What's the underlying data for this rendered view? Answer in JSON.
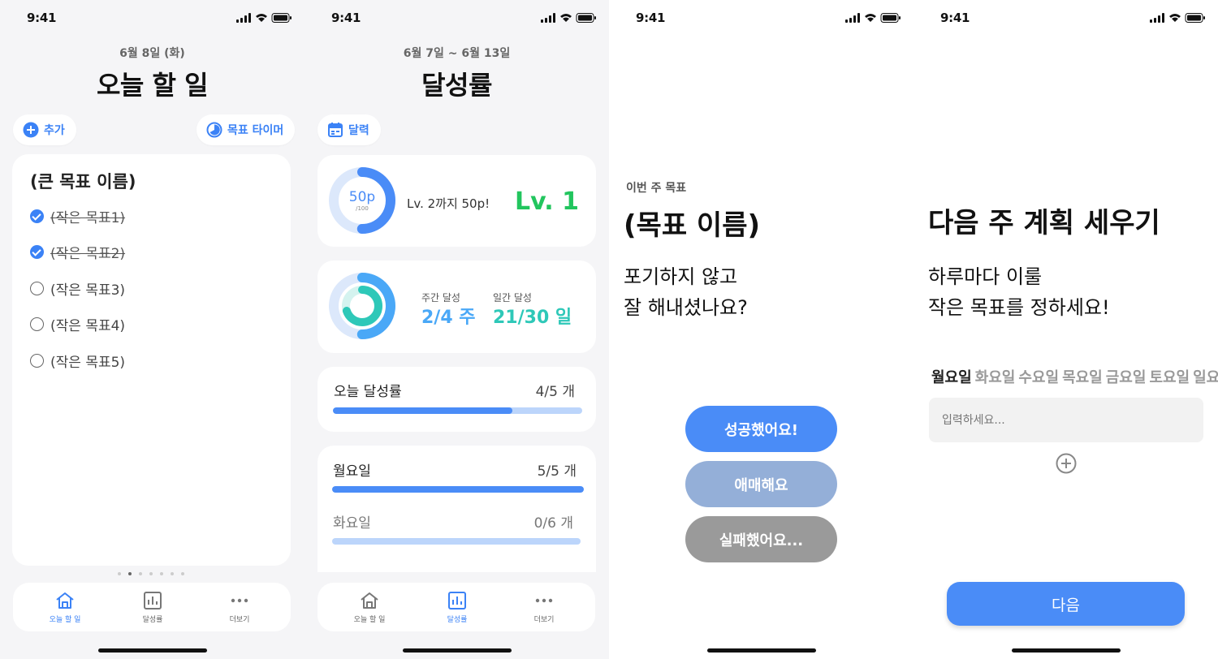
{
  "status_bar": {
    "time": "9:41"
  },
  "screen1": {
    "date": "6월 8일 (화)",
    "title": "오늘 할 일",
    "add_label": "추가",
    "timer_label": "목표 타이머",
    "goal_title": "(큰 목표 이름)",
    "tasks": [
      {
        "label": "(작은 목표1)",
        "done": true
      },
      {
        "label": "(작은 목표2)",
        "done": true
      },
      {
        "label": "(작은 목표3)",
        "done": false
      },
      {
        "label": "(작은 목표4)",
        "done": false
      },
      {
        "label": "(작은 목표5)",
        "done": false
      }
    ],
    "page_dots": {
      "count": 7,
      "active": 1
    }
  },
  "screen2": {
    "date": "6월 7일 ~ 6월 13일",
    "title": "달성률",
    "calendar_label": "달력",
    "level": {
      "points": "50p",
      "points_max": "/100",
      "progress": 0.5,
      "next_text": "Lv. 2까지 50p!",
      "level_text": "Lv. 1"
    },
    "weekly": {
      "label": "주간 달성",
      "value": "2/4 주",
      "progress": 0.5
    },
    "daily": {
      "label": "일간 달성",
      "value": "21/30 일",
      "progress": 0.7
    },
    "today": {
      "label": "오늘 달성률",
      "value": "4/5 개",
      "progress": 0.72
    },
    "days": [
      {
        "label": "월요일",
        "value": "5/5 개",
        "progress": 1.0
      },
      {
        "label": "화요일",
        "value": "0/6 개",
        "progress": 0.0
      }
    ]
  },
  "tabs": {
    "home": "오늘 할 일",
    "stats": "달성률",
    "more": "더보기"
  },
  "screen3": {
    "subtitle": "이번 주 목표",
    "title": "(목표 이름)",
    "question_line1": "포기하지 않고",
    "question_line2": "잘 해내셨나요?",
    "success": "성공했어요!",
    "ambiguous": "애매해요",
    "fail": "실패했어요...",
    "colors": {
      "success": "#4a8cf7",
      "ambiguous": "#94afd8",
      "fail": "#9a9a9a"
    }
  },
  "screen4": {
    "title": "다음 주 계획 세우기",
    "desc_line1": "하루마다 이룰",
    "desc_line2": "작은 목표를 정하세요!",
    "days": [
      "월요일",
      "화요일",
      "수요일",
      "목요일",
      "금요일",
      "토요일",
      "일요일"
    ],
    "active_day": 0,
    "input_placeholder": "입력하세요...",
    "next": "다음"
  }
}
